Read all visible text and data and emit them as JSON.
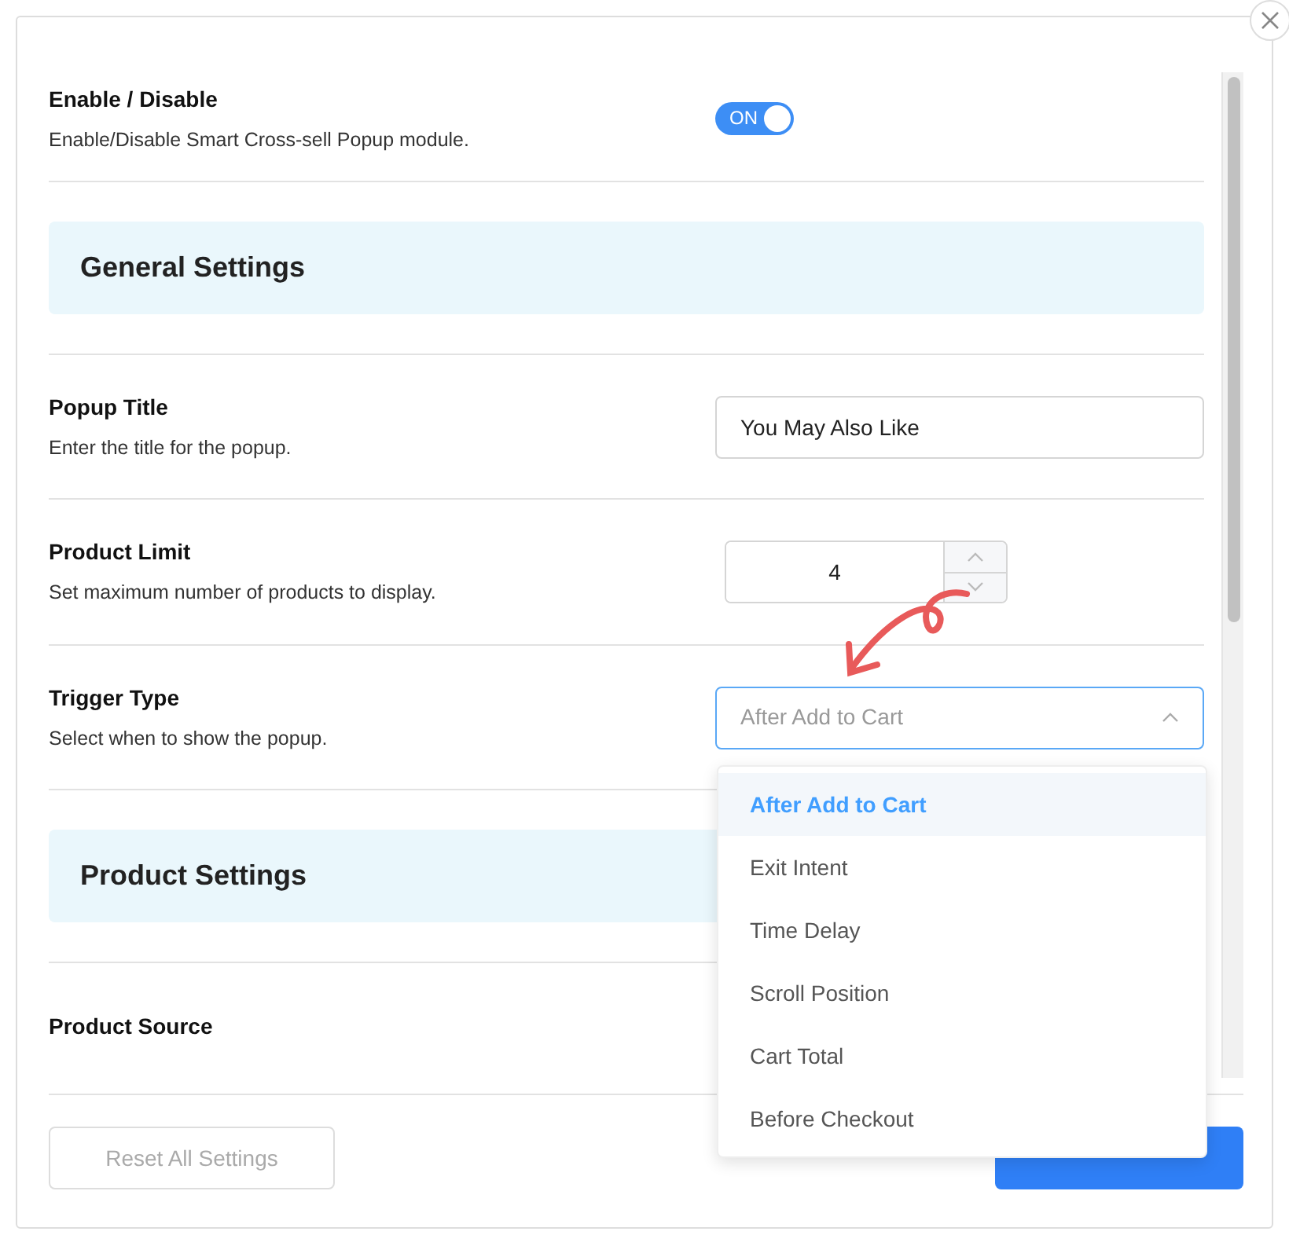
{
  "rows": [
    {
      "kind": "toggle",
      "label": "Enable / Disable",
      "description": "Enable/Disable Smart Cross-sell Popup module.",
      "toggle": {
        "on": true,
        "text": "ON"
      }
    },
    {
      "kind": "header",
      "title": "General Settings"
    },
    {
      "kind": "text",
      "label": "Popup Title",
      "description": "Enter the title for the popup.",
      "value": "You May Also Like"
    },
    {
      "kind": "number",
      "label": "Product Limit",
      "description": "Set maximum number of products to display.",
      "value": "4"
    },
    {
      "kind": "select",
      "label": "Trigger Type",
      "description": "Select when to show the popup.",
      "value": "After Add to Cart",
      "open": true,
      "options": [
        {
          "label": "After Add to Cart",
          "selected": true
        },
        {
          "label": "Exit Intent",
          "selected": false
        },
        {
          "label": "Time Delay",
          "selected": false
        },
        {
          "label": "Scroll Position",
          "selected": false
        },
        {
          "label": "Cart Total",
          "selected": false
        },
        {
          "label": "Before Checkout",
          "selected": false
        }
      ]
    },
    {
      "kind": "header",
      "title": "Product Settings"
    },
    {
      "kind": "plain",
      "label": "Product Source"
    }
  ],
  "footer": {
    "buttons": [
      {
        "kind": "secondary",
        "label": "Reset All Settings"
      },
      {
        "kind": "primary"
      }
    ]
  }
}
